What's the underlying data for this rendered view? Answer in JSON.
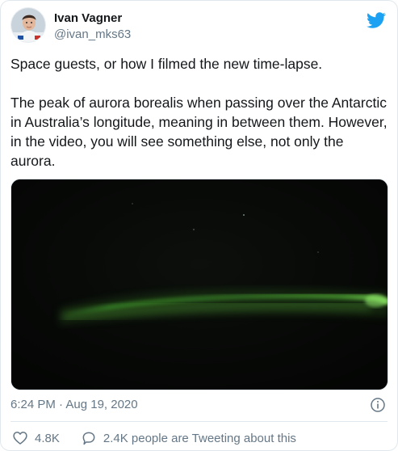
{
  "author": {
    "display_name": "Ivan Vagner",
    "handle": "@ivan_mks63",
    "avatar_icon": "user-avatar"
  },
  "brand": {
    "icon": "twitter-bird-icon",
    "color": "#1da1f2"
  },
  "tweet": {
    "text": "Space guests, or how I filmed the new time-lapse.\n\nThe peak of aurora borealis when passing over the Antarctic in Australia’s longitude, meaning in between them. However, in the video, you will see something else, not only the aurora.",
    "media_icon": "video-thumbnail",
    "timestamp": "6:24 PM · Aug 19, 2020",
    "info_icon": "info-icon"
  },
  "actions": {
    "like_count": "4.8K",
    "like_icon": "heart-icon",
    "reply_label": "2.4K people are Tweeting about this",
    "reply_icon": "comment-bubble-icon"
  }
}
